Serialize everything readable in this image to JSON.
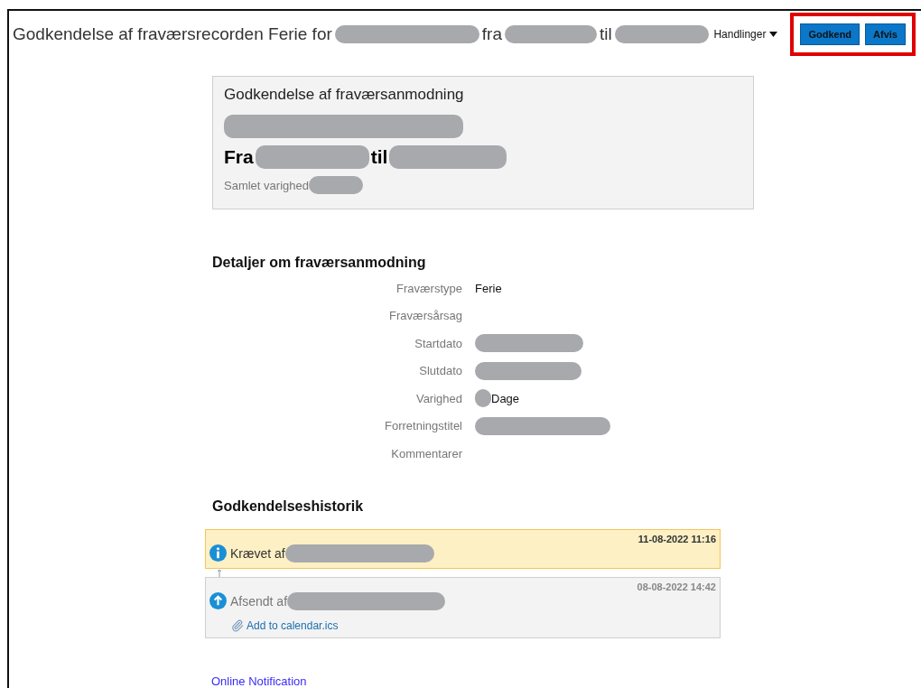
{
  "header": {
    "title_parts": [
      {
        "text": "Godkendelse af fraværsrecorden Ferie for"
      },
      {
        "redacted": true
      },
      {
        "text": "fra"
      },
      {
        "redacted": true
      },
      {
        "text": "til"
      },
      {
        "redacted": true
      }
    ],
    "actions_menu": "Handlinger",
    "buttons": [
      {
        "label": "Godkend"
      },
      {
        "label": "Afvis"
      }
    ],
    "buttons_highlighted": true
  },
  "summary": {
    "title": "Godkendelse af fraværsanmodning",
    "name": {
      "redacted": true
    },
    "range_parts": [
      {
        "text": "Fra"
      },
      {
        "redacted": true
      },
      {
        "text": "til"
      },
      {
        "redacted": true
      }
    ],
    "duration_label": "Samlet varighed",
    "duration": {
      "redacted": true
    }
  },
  "details": {
    "heading": "Detaljer om fraværsanmodning",
    "rows": [
      {
        "label": "Fraværstype",
        "parts": [
          {
            "text": "Ferie"
          }
        ]
      },
      {
        "label": "Fraværsårsag"
      },
      {
        "label": "Startdato",
        "parts": [
          {
            "redacted": true
          }
        ]
      },
      {
        "label": "Slutdato",
        "parts": [
          {
            "redacted": true
          }
        ]
      },
      {
        "label": "Varighed",
        "parts": [
          {
            "redacted": true
          },
          {
            "text": "Dage"
          }
        ]
      },
      {
        "label": "Forretningstitel",
        "parts": [
          {
            "redacted": true
          }
        ]
      },
      {
        "label": "Kommentarer"
      }
    ]
  },
  "history": {
    "heading": "Godkendelseshistorik",
    "entries": [
      {
        "kind": "info",
        "selected": true,
        "time": "11-08-2022 11:16",
        "action": "Krævet af",
        "actor": {
          "redacted": true
        }
      },
      {
        "kind": "submitted",
        "selected": false,
        "time": "08-08-2022 14:42",
        "action": "Afsendt af",
        "actor": {
          "redacted": true
        },
        "attachment": "Add to calendar.ics"
      }
    ]
  },
  "footer_link": "Online Notification"
}
